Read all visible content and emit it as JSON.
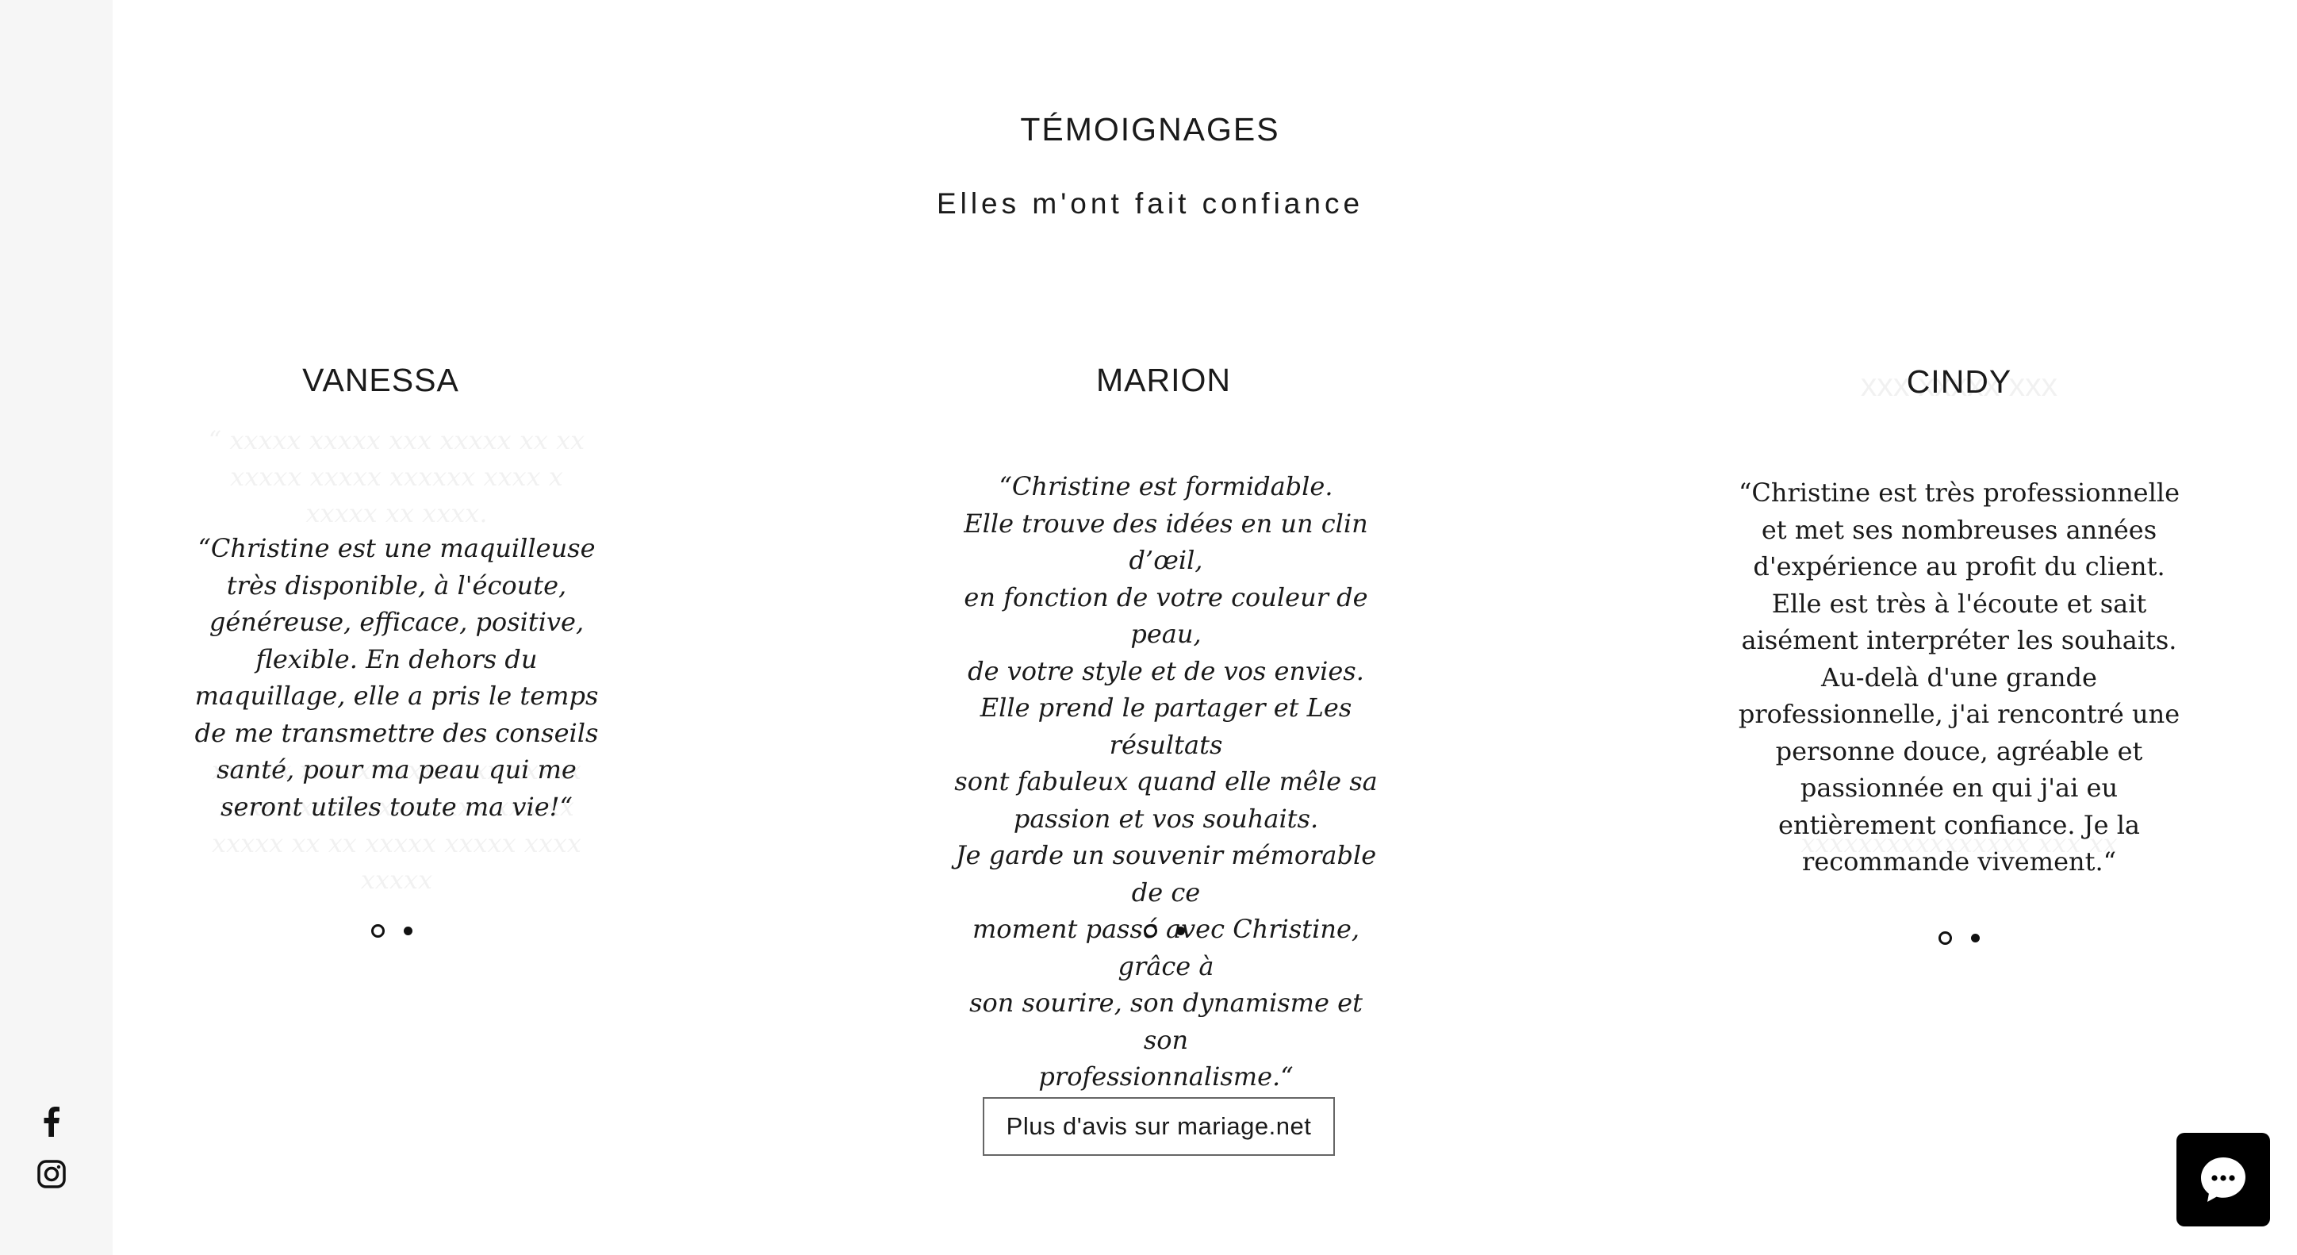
{
  "sidebar": {
    "social": [
      {
        "name": "facebook-icon"
      },
      {
        "name": "instagram-icon"
      }
    ]
  },
  "section": {
    "title": "TÉMOIGNAGES",
    "subtitle": "Elles m'ont fait confiance"
  },
  "testimonials": [
    {
      "name": "VANESSA",
      "quote": "“Christine est une maquilleuse très disponible, à l'écoute, généreuse, efficace, positive, flexible. En dehors du maquillage, elle a pris le temps de me transmettre des conseils santé, pour ma peau qui me seront utiles toute ma vie!“"
    },
    {
      "name": "MARION",
      "quote_lines": [
        "“Christine est formidable.",
        "Elle trouve des idées en un clin d’œil,",
        "en fonction de votre couleur de peau,",
        "de votre style et de vos envies.",
        "Elle prend le partager et Les résultats",
        "sont fabuleux quand elle mêle sa",
        "passion et vos souhaits.",
        "Je garde un souvenir mémorable de ce",
        "moment passé avec Christine, grâce à",
        "son sourire, son dynamisme et son",
        "professionnalisme.“"
      ]
    },
    {
      "name": "CINDY",
      "quote": "“Christine est très professionnelle et met ses nombreuses années d'expérience au profit du client. Elle est très à l'écoute et sait aisément interpréter les souhaits. Au-delà d'une grande professionnelle, j'ai rencontré une personne douce, agréable et passionnée en qui j'ai eu entièrement confiance. Je la recommande vivement.“"
    }
  ],
  "cta": {
    "label": "Plus d'avis sur mariage.net"
  },
  "chat": {
    "icon": "chat-bubble-icon"
  },
  "colors": {
    "sidebar_bg": "#f6f6f6",
    "text": "#1a1a1a",
    "chat_bg": "#000000"
  }
}
